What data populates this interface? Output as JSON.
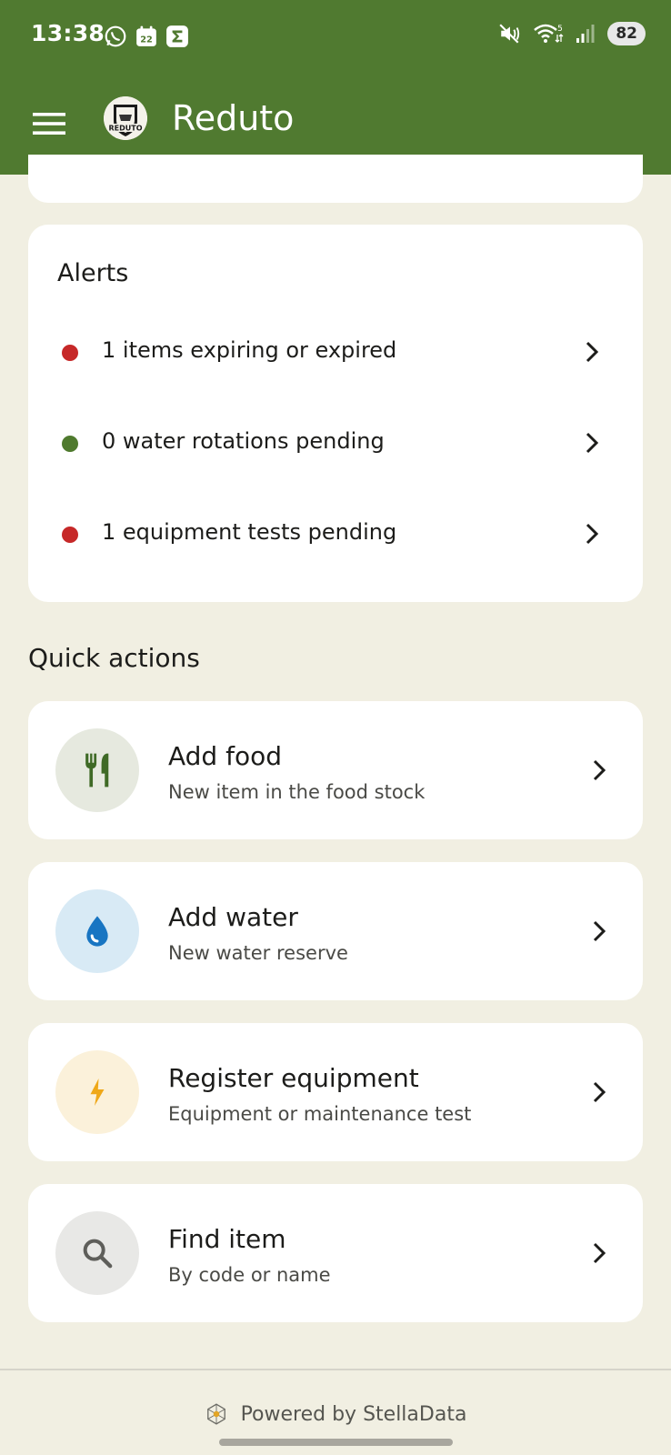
{
  "status": {
    "time": "13:38",
    "calendar_day": "22",
    "battery": "82",
    "wifi_label": "5"
  },
  "app": {
    "title": "Reduto",
    "logo_text": "REDUTO"
  },
  "alerts": {
    "title": "Alerts",
    "items": [
      {
        "label": "1 items expiring or expired",
        "status_color": "#C62828"
      },
      {
        "label": "0 water rotations pending",
        "status_color": "#4F7A2E"
      },
      {
        "label": "1 equipment tests pending",
        "status_color": "#C62828"
      }
    ]
  },
  "quick_actions": {
    "title": "Quick actions",
    "items": [
      {
        "title": "Add food",
        "subtitle": "New item in the food stock",
        "icon": "fork-knife-icon",
        "bg": "#E6E9DF",
        "fg": "#3F6A26"
      },
      {
        "title": "Add water",
        "subtitle": "New water reserve",
        "icon": "water-drop-icon",
        "bg": "#D8EAF5",
        "fg": "#1875C2"
      },
      {
        "title": "Register equipment",
        "subtitle": "Equipment or maintenance test",
        "icon": "lightning-icon",
        "bg": "#FBF1DA",
        "fg": "#EFA818"
      },
      {
        "title": "Find item",
        "subtitle": "By code or name",
        "icon": "search-icon",
        "bg": "#E8E8E6",
        "fg": "#5E5E5A"
      }
    ]
  },
  "footer": {
    "text": "Powered by StellaData"
  },
  "colors": {
    "brand": "#507A30",
    "background": "#F1EFE2"
  }
}
